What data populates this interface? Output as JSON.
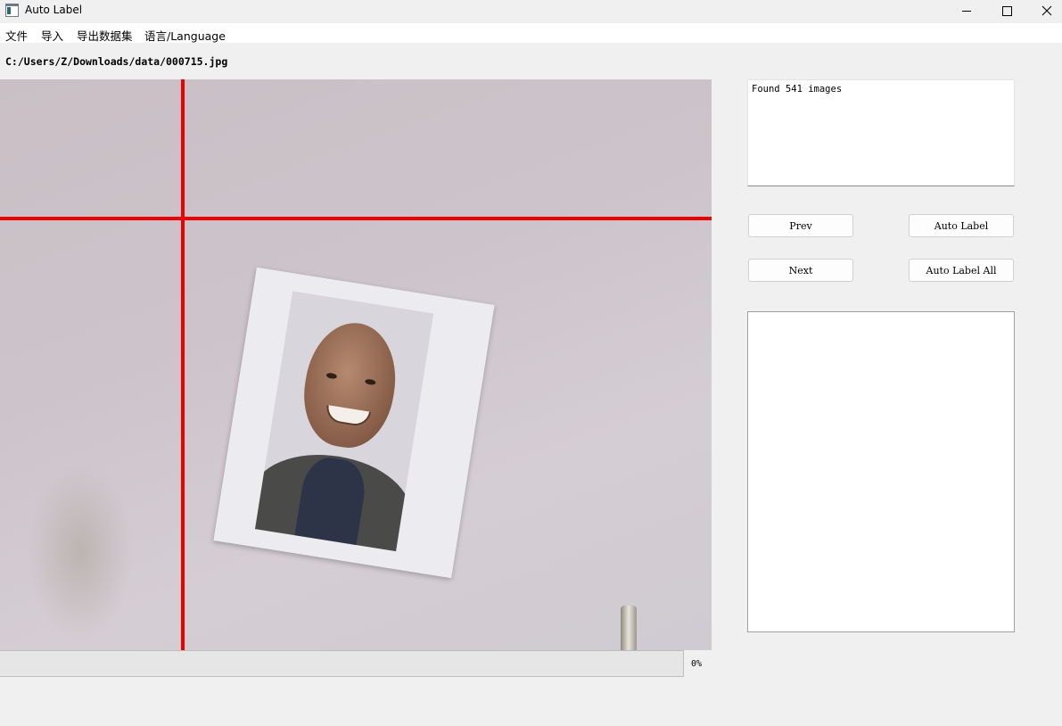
{
  "window": {
    "title": "Auto Label",
    "icon": "app-window-icon",
    "controls": [
      "minimize-icon",
      "maximize-icon",
      "close-icon"
    ]
  },
  "menu": {
    "items": [
      {
        "label": "文件"
      },
      {
        "label": "导入"
      },
      {
        "label": "导出数据集"
      },
      {
        "label": "语言/Language"
      }
    ]
  },
  "main": {
    "file_path": "C:/Users/Z/Downloads/data/000715.jpg",
    "progress": {
      "value": 0,
      "text": "0%"
    }
  },
  "side_panel": {
    "log_text": "Found 541 images",
    "buttons": {
      "prev": "Prev",
      "auto_label": "Auto Label",
      "next": "Next",
      "auto_label_all": "Auto Label All"
    }
  },
  "colors": {
    "guide_lines": "#ee0000",
    "progress_fill": "#06b025"
  }
}
